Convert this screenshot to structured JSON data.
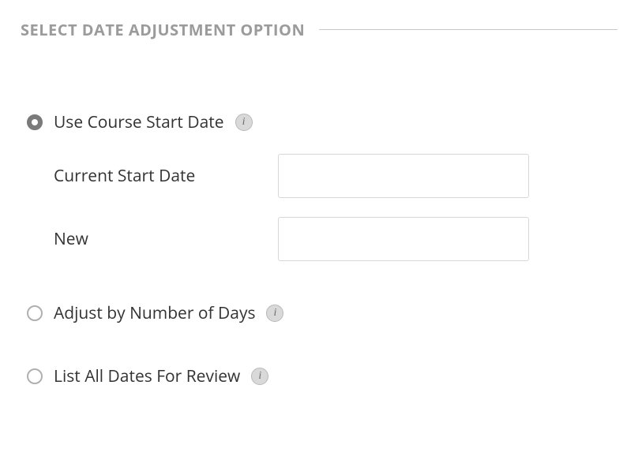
{
  "section": {
    "title": "SELECT DATE ADJUSTMENT OPTION"
  },
  "options": {
    "use_course_start_date": {
      "label": "Use Course Start Date",
      "selected": true,
      "fields": {
        "current_label": "Current Start Date",
        "current_value": "",
        "new_label": "New",
        "new_value": ""
      }
    },
    "adjust_by_days": {
      "label": "Adjust by Number of Days",
      "selected": false
    },
    "list_all_dates": {
      "label": "List All Dates For Review",
      "selected": false
    }
  },
  "icons": {
    "info_glyph": "i"
  }
}
